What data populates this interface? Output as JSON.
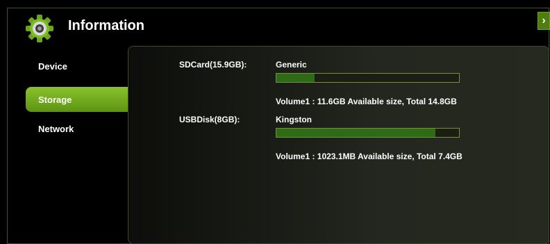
{
  "header": {
    "title": "Information",
    "gear_icon": "gear-icon",
    "close_icon": "chevron-right-icon"
  },
  "sidebar": {
    "items": [
      {
        "label": "Device",
        "active": false
      },
      {
        "label": "Storage",
        "active": true
      },
      {
        "label": "Network",
        "active": false
      }
    ]
  },
  "storage": {
    "devices": [
      {
        "label": "SDCard(15.9GB):",
        "name": "Generic",
        "usage_fraction": 0.21,
        "volume_text": "Volume1 : 11.6GB Available size, Total 14.8GB"
      },
      {
        "label": "USBDisk(8GB):",
        "name": "Kingston",
        "usage_fraction": 0.87,
        "volume_text": "Volume1 : 1023.1MB Available size, Total 7.4GB"
      }
    ]
  },
  "colors": {
    "accent": "#6ea31c",
    "bar_fill": "#2e6b16"
  }
}
